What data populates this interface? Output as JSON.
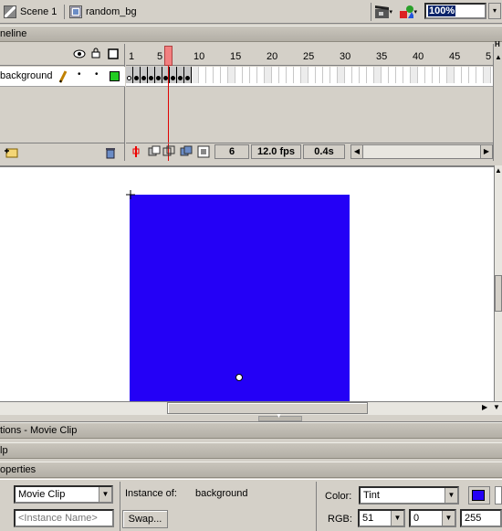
{
  "breadcrumb": {
    "scene": "Scene 1",
    "symbol": "random_bg"
  },
  "toolbar": {
    "zoom": "100%",
    "edit_scene_icon": "clapper-icon",
    "edit_symbol_icon": "shapes-icon"
  },
  "timeline": {
    "panel_title": "neline",
    "frame_numbers": [
      "1",
      "5",
      "10",
      "15",
      "20",
      "25",
      "30",
      "35",
      "40",
      "45",
      "5"
    ],
    "layer": {
      "name": "background"
    },
    "status": {
      "current_frame": "6",
      "fps": "12.0 fps",
      "elapsed": "0.4s"
    },
    "ruler_right_label": "H"
  },
  "panels": {
    "actions_title": "tions - Movie Clip",
    "help_title": "lp",
    "properties_title": "operties"
  },
  "properties": {
    "symbol_behavior": "Movie Clip",
    "instance_of_label": "Instance of:",
    "instance_of_value": "background",
    "instance_name_placeholder": "<Instance Name>",
    "swap_label": "Swap...",
    "color_label": "Color:",
    "color_value": "Tint",
    "rgb_label": "RGB:",
    "rgb_r": "51",
    "rgb_g": "0",
    "rgb_b": "255"
  },
  "colors": {
    "stage_rect": "#2400f6",
    "playhead": "#f28080",
    "layer_color": "#22cc22"
  }
}
